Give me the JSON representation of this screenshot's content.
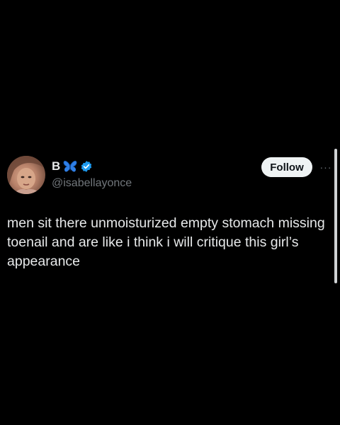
{
  "author": {
    "display_name": "B",
    "handle": "@isabellayonce",
    "name_emoji": "butterfly-icon",
    "verified_icon": "verified-badge-icon",
    "verified_color": "#1d9bf0"
  },
  "actions": {
    "follow_label": "Follow",
    "more_label": "···"
  },
  "tweet": {
    "text": "men sit there unmoisturized empty stomach missing toenail and are like i think i will critique this girl’s appearance"
  },
  "colors": {
    "background": "#000000",
    "text": "#e7e9ea",
    "secondary_text": "#71767b",
    "follow_bg": "#eff3f4",
    "follow_text": "#0f1419"
  }
}
